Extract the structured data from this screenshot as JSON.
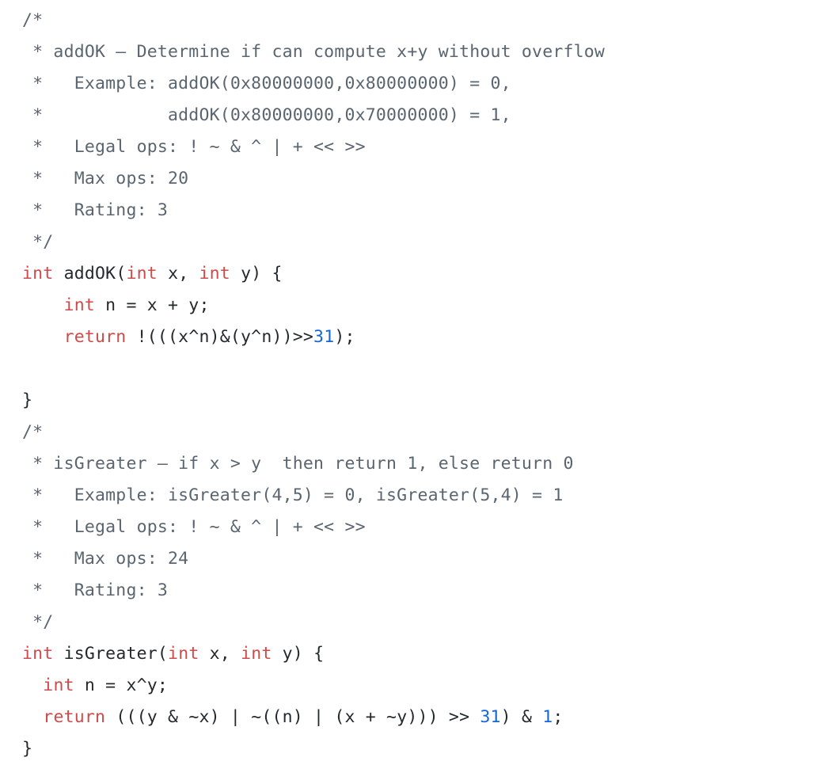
{
  "editor": {
    "language": "c",
    "background": "#ffffff",
    "colors": {
      "comment": "#5a6570",
      "keyword": "#cf4a4a",
      "function": "#6f42c1",
      "number": "#1267d4",
      "plain": "#24292e"
    }
  },
  "code": {
    "lines": [
      {
        "index": 1,
        "text": "/*",
        "tokens": [
          {
            "t": "/*",
            "c": "comment"
          }
        ]
      },
      {
        "index": 2,
        "text": " * addOK – Determine if can compute x+y without overflow",
        "tokens": [
          {
            "t": " * addOK – Determine if can compute x+y without overflow",
            "c": "comment"
          }
        ]
      },
      {
        "index": 3,
        "text": " *   Example: addOK(0x80000000,0x80000000) = 0,",
        "tokens": [
          {
            "t": " *   Example: addOK(0x80000000,0x80000000) = 0,",
            "c": "comment"
          }
        ]
      },
      {
        "index": 4,
        "text": " *            addOK(0x80000000,0x70000000) = 1,",
        "tokens": [
          {
            "t": " *            addOK(0x80000000,0x70000000) = 1,",
            "c": "comment"
          }
        ]
      },
      {
        "index": 5,
        "text": " *   Legal ops: ! ~ & ^ | + << >>",
        "tokens": [
          {
            "t": " *   Legal ops: ! ~ & ^ | + << >>",
            "c": "comment"
          }
        ]
      },
      {
        "index": 6,
        "text": " *   Max ops: 20",
        "tokens": [
          {
            "t": " *   Max ops: 20",
            "c": "comment"
          }
        ]
      },
      {
        "index": 7,
        "text": " *   Rating: 3",
        "tokens": [
          {
            "t": " *   Rating: 3",
            "c": "comment"
          }
        ]
      },
      {
        "index": 8,
        "text": " */",
        "tokens": [
          {
            "t": " */",
            "c": "comment"
          }
        ]
      },
      {
        "index": 9,
        "text": "int addOK(int x, int y) {",
        "tokens": [
          {
            "t": "int",
            "c": "keyword"
          },
          {
            "t": " ",
            "c": "plain"
          },
          {
            "t": "addOK",
            "c": "function"
          },
          {
            "t": "(",
            "c": "plain"
          },
          {
            "t": "int",
            "c": "keyword"
          },
          {
            "t": " x, ",
            "c": "plain"
          },
          {
            "t": "int",
            "c": "keyword"
          },
          {
            "t": " y) {",
            "c": "plain"
          }
        ]
      },
      {
        "index": 10,
        "text": "    int n = x + y;",
        "tokens": [
          {
            "t": "    ",
            "c": "plain"
          },
          {
            "t": "int",
            "c": "keyword"
          },
          {
            "t": " n = x + y;",
            "c": "plain"
          }
        ]
      },
      {
        "index": 11,
        "text": "    return !(((x^n)&(y^n))>>31);",
        "tokens": [
          {
            "t": "    ",
            "c": "plain"
          },
          {
            "t": "return",
            "c": "keyword"
          },
          {
            "t": " !(((x^n)&(y^n))>>",
            "c": "plain"
          },
          {
            "t": "31",
            "c": "number"
          },
          {
            "t": ");",
            "c": "plain"
          }
        ]
      },
      {
        "index": 12,
        "text": "",
        "tokens": []
      },
      {
        "index": 13,
        "text": "}",
        "tokens": [
          {
            "t": "}",
            "c": "plain"
          }
        ]
      },
      {
        "index": 14,
        "text": "/*",
        "tokens": [
          {
            "t": "/*",
            "c": "comment"
          }
        ]
      },
      {
        "index": 15,
        "text": " * isGreater – if x > y  then return 1, else return 0",
        "tokens": [
          {
            "t": " * isGreater – if x > y  then return 1, else return 0",
            "c": "comment"
          }
        ]
      },
      {
        "index": 16,
        "text": " *   Example: isGreater(4,5) = 0, isGreater(5,4) = 1",
        "tokens": [
          {
            "t": " *   Example: isGreater(4,5) = 0, isGreater(5,4) = 1",
            "c": "comment"
          }
        ]
      },
      {
        "index": 17,
        "text": " *   Legal ops: ! ~ & ^ | + << >>",
        "tokens": [
          {
            "t": " *   Legal ops: ! ~ & ^ | + << >>",
            "c": "comment"
          }
        ]
      },
      {
        "index": 18,
        "text": " *   Max ops: 24",
        "tokens": [
          {
            "t": " *   Max ops: 24",
            "c": "comment"
          }
        ]
      },
      {
        "index": 19,
        "text": " *   Rating: 3",
        "tokens": [
          {
            "t": " *   Rating: 3",
            "c": "comment"
          }
        ]
      },
      {
        "index": 20,
        "text": " */",
        "tokens": [
          {
            "t": " */",
            "c": "comment"
          }
        ]
      },
      {
        "index": 21,
        "text": "int isGreater(int x, int y) {",
        "tokens": [
          {
            "t": "int",
            "c": "keyword"
          },
          {
            "t": " ",
            "c": "plain"
          },
          {
            "t": "isGreater",
            "c": "function"
          },
          {
            "t": "(",
            "c": "plain"
          },
          {
            "t": "int",
            "c": "keyword"
          },
          {
            "t": " x, ",
            "c": "plain"
          },
          {
            "t": "int",
            "c": "keyword"
          },
          {
            "t": " y) {",
            "c": "plain"
          }
        ]
      },
      {
        "index": 22,
        "text": "  int n = x^y;",
        "tokens": [
          {
            "t": "  ",
            "c": "plain"
          },
          {
            "t": "int",
            "c": "keyword"
          },
          {
            "t": " n = x^y;",
            "c": "plain"
          }
        ]
      },
      {
        "index": 23,
        "text": "  return (((y & ~x) | ~((n) | (x + ~y))) >> 31) & 1;",
        "tokens": [
          {
            "t": "  ",
            "c": "plain"
          },
          {
            "t": "return",
            "c": "keyword"
          },
          {
            "t": " (((y & ~x) | ~((n) | (x + ~y))) >> ",
            "c": "plain"
          },
          {
            "t": "31",
            "c": "number"
          },
          {
            "t": ") & ",
            "c": "plain"
          },
          {
            "t": "1",
            "c": "number"
          },
          {
            "t": ";",
            "c": "plain"
          }
        ]
      },
      {
        "index": 24,
        "text": "}",
        "tokens": [
          {
            "t": "}",
            "c": "plain"
          }
        ]
      }
    ]
  }
}
